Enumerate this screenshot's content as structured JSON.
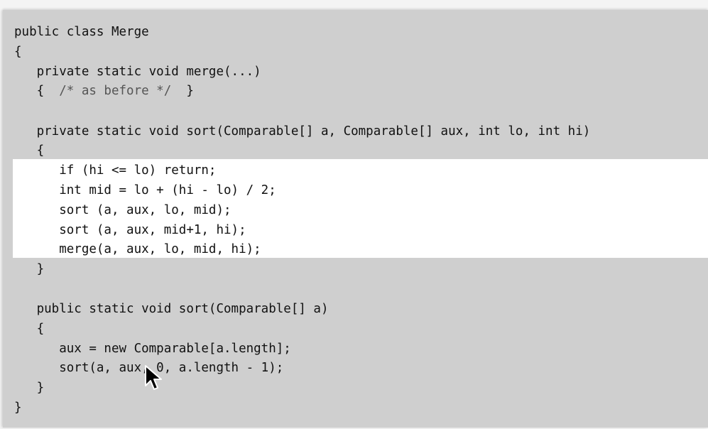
{
  "code": {
    "lines": [
      "public class Merge",
      "{",
      "   private static void merge(...)",
      "   {  /* as before */  }",
      "",
      "   private static void sort(Comparable[] a, Comparable[] aux, int lo, int hi)",
      "   {",
      "      if (hi <= lo) return;",
      "      int mid = lo + (hi - lo) / 2;",
      "      sort (a, aux, lo, mid);",
      "      sort (a, aux, mid+1, hi);",
      "      merge(a, aux, lo, mid, hi);",
      "   }",
      "",
      "   public static void sort(Comparable[] a)",
      "   {",
      "      aux = new Comparable[a.length];",
      "      sort(a, aux, 0, a.length - 1);",
      "   }",
      "}"
    ],
    "highlight_lines": [
      7,
      8,
      9,
      10,
      11
    ]
  },
  "colors": {
    "panel_background": "#cfcfcf",
    "highlight_background": "#ffffff",
    "text": "#111111",
    "comment": "#555555"
  },
  "icons": {
    "pointer": "mouse-pointer-icon"
  }
}
